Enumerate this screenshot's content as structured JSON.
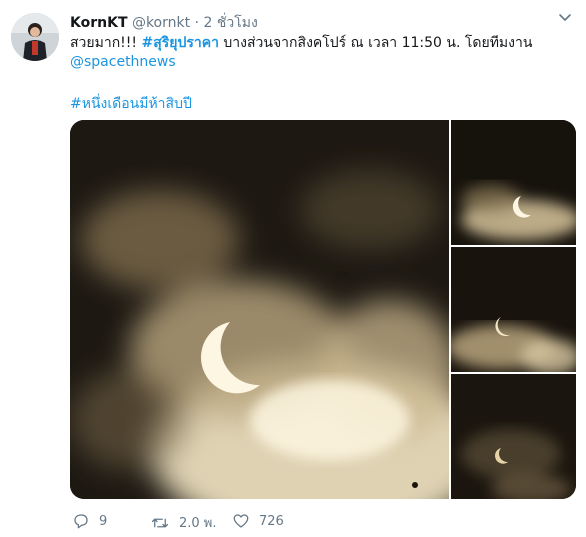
{
  "tweet": {
    "author_name": "KornKT",
    "author_handle": "@kornkt",
    "separator": "·",
    "time": "2 ชั่วโมง",
    "text_prefix": "สวยมาก!!! ",
    "hashtag_main": "#สุริยุปราคา",
    "text_rest": " บางส่วนจากสิงคโปร์ ณ เวลา 11:50 น. โดยทีมงาน",
    "mention": "@spacethnews",
    "hashtag_second": "#หนึ่งเดือนมีห้าสิบปี"
  },
  "media": {
    "photos": [
      "solar-eclipse-main",
      "solar-eclipse-2",
      "solar-eclipse-3",
      "solar-eclipse-4"
    ]
  },
  "actions": {
    "reply_count": "9",
    "retweet_count": "2.0 พ.",
    "like_count": "726",
    "reply_icon": "reply-icon",
    "retweet_icon": "retweet-icon",
    "like_icon": "heart-icon"
  },
  "colors": {
    "link": "#1b95e0",
    "muted": "#657786",
    "text": "#14171a"
  }
}
